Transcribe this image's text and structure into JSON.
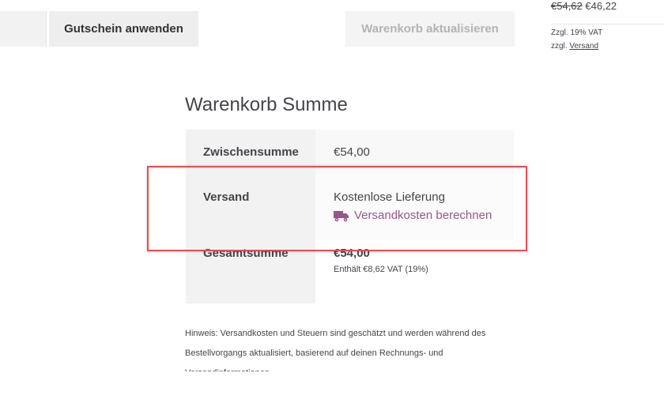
{
  "coupon": {
    "apply_label": "Gutschein anwenden"
  },
  "cart": {
    "update_label": "Warenkorb aktualisieren"
  },
  "mini_cart": {
    "old_price": "€54,62",
    "new_price": "€46,22",
    "tax_note": "Zzgl. 19% VAT",
    "shipping_prefix": "zzgl.",
    "shipping_link": "Versand"
  },
  "totals": {
    "title": "Warenkorb Summe",
    "subtotal": {
      "label": "Zwischensumme",
      "value": "€54,00"
    },
    "shipping": {
      "label": "Versand",
      "method": "Kostenlose Lieferung",
      "calc_link": "Versandkosten berechnen",
      "icon": "truck-icon"
    },
    "total": {
      "label": "Gesamtsumme",
      "value": "€54,00",
      "vat": "Enthält €8,62 VAT (19%)"
    }
  },
  "notice": "Hinweis: Versandkosten und Steuern sind geschätzt und werden während des Bestellvorgangs aktualisiert, basierend auf deinen Rechnungs- und Versandinformationen.",
  "colors": {
    "accent": "#96588a",
    "highlight": "#e35050"
  }
}
